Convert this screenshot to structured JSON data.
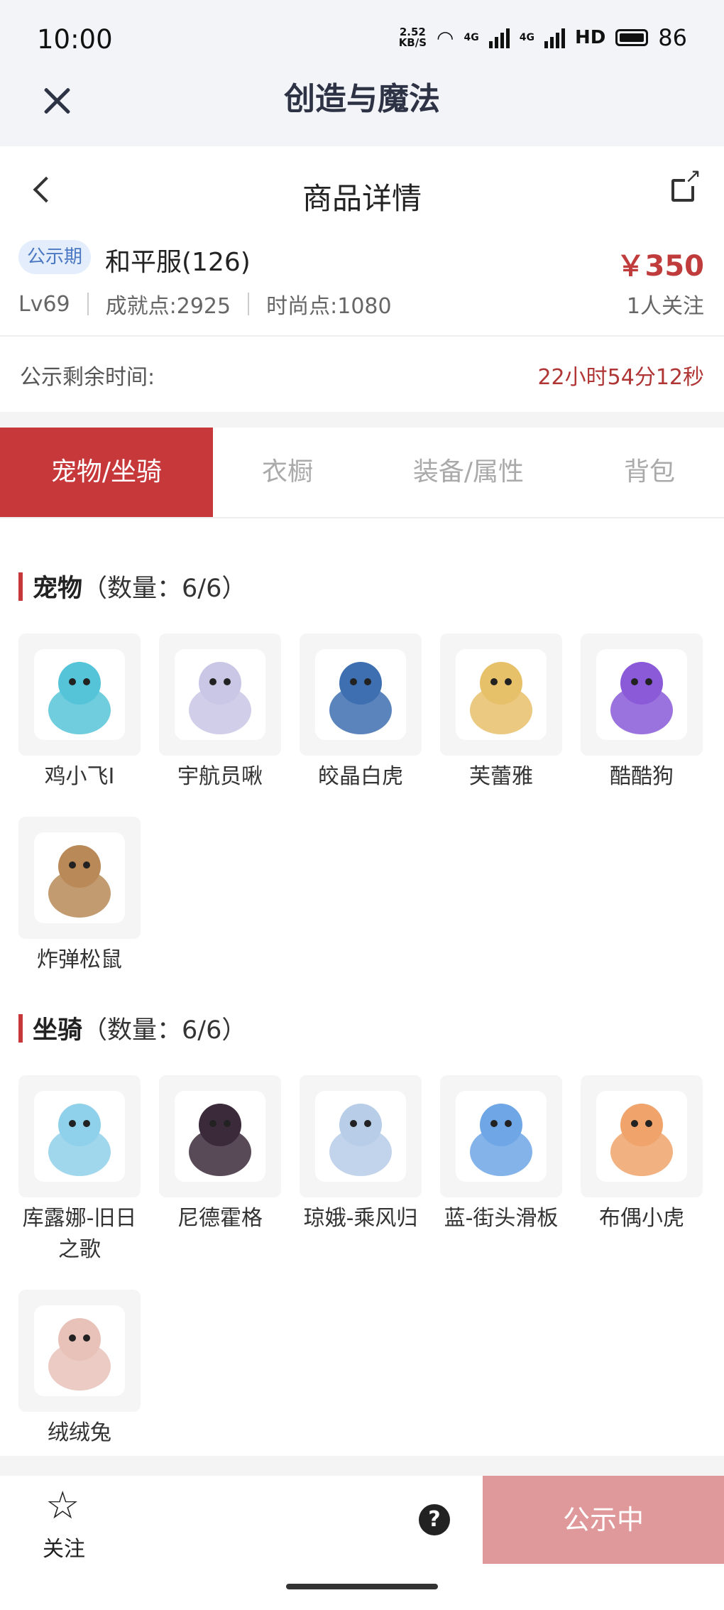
{
  "status_bar": {
    "time": "10:00",
    "speed_value": "2.52",
    "speed_unit": "KB/S",
    "network1": "4G",
    "network2": "4G",
    "hd_label": "HD",
    "battery": "86"
  },
  "app_bar": {
    "title": "创造与魔法",
    "close_icon": "close-icon"
  },
  "nav": {
    "title": "商品详情",
    "back_icon": "chevron-left-icon",
    "share_icon": "share-icon"
  },
  "product": {
    "tag": "公示期",
    "server": "和平服(126)",
    "price": "￥350",
    "level": "Lv69",
    "achievement": "成就点:2925",
    "fashion": "时尚点:1080",
    "followers": "1人关注"
  },
  "remaining": {
    "label": "公示剩余时间:",
    "value": "22小时54分12秒"
  },
  "tabs": [
    "宠物/坐骑",
    "衣橱",
    "装备/属性",
    "背包"
  ],
  "active_tab": "宠物/坐骑",
  "pets": {
    "title": "宠物",
    "count": "（数量：6/6）",
    "items": [
      {
        "name": "鸡小飞I",
        "color": "#56c4d8"
      },
      {
        "name": "宇航员啾",
        "color": "#c9c6e6"
      },
      {
        "name": "皎晶白虎",
        "color": "#3e6fb0"
      },
      {
        "name": "芙蕾雅",
        "color": "#e7c06a"
      },
      {
        "name": "酷酷狗",
        "color": "#8a5ad8"
      },
      {
        "name": "炸弹松鼠",
        "color": "#b98a58"
      }
    ]
  },
  "mounts": {
    "title": "坐骑",
    "count": "（数量：6/6）",
    "items": [
      {
        "name": "库露娜-旧日之歌",
        "color": "#8fd0ea"
      },
      {
        "name": "尼德霍格",
        "color": "#3b2a3a"
      },
      {
        "name": "琼娥-乘风归",
        "color": "#b7cde8"
      },
      {
        "name": "蓝-街头滑板",
        "color": "#6fa6e6"
      },
      {
        "name": "布偶小虎",
        "color": "#f0a36a"
      },
      {
        "name": "绒绒兔",
        "color": "#e8c2b8"
      }
    ]
  },
  "bottom": {
    "follow_label": "关注",
    "star_icon": "star-outline-icon",
    "help_icon": "help-icon",
    "help_glyph": "?",
    "status_button": "公示中"
  },
  "colors": {
    "accent": "#c6383a",
    "price": "#c03c3c",
    "disabled_button": "#e0999b",
    "tag_bg": "#e3edfb",
    "tag_text": "#4a78c2"
  }
}
